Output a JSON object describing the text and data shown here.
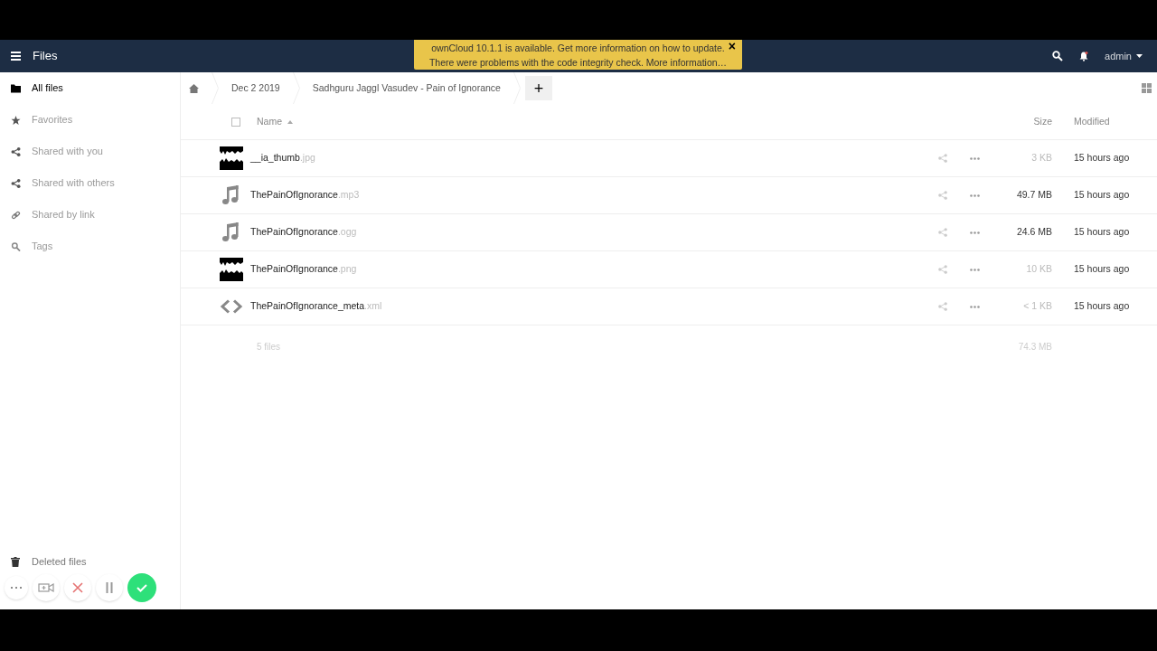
{
  "header": {
    "app_title": "Files",
    "user": "admin"
  },
  "notification": {
    "lines": [
      "ownCloud 10.1.1 is available. Get more information on how to update.",
      "There were problems with the code integrity check. More information…"
    ],
    "close": "×"
  },
  "sidebar": {
    "items": [
      {
        "label": "All files",
        "selected": true
      },
      {
        "label": "Favorites",
        "selected": false
      },
      {
        "label": "Shared with you",
        "selected": false
      },
      {
        "label": "Shared with others",
        "selected": false
      },
      {
        "label": "Shared by link",
        "selected": false
      },
      {
        "label": "Tags",
        "selected": false
      }
    ],
    "footer": {
      "label": "Deleted files"
    }
  },
  "breadcrumbs": [
    "Dec 2 2019",
    "Sadhguru Jaggl Vasudev - Pain of Ignorance"
  ],
  "new_button": "+",
  "table": {
    "select_all": {
      "checked": false
    },
    "columns": {
      "name": "Name",
      "size": "Size",
      "modified": "Modified"
    },
    "rows": [
      {
        "name": "__ia_thumb",
        "ext": ".jpg",
        "size": "3 KB",
        "size_emphasized": false,
        "modified": "15 hours ago"
      },
      {
        "kind": "audio",
        "name": "ThePainOfIgnorance",
        "ext": ".mp3",
        "size": "49.7 MB",
        "size_emphasized": true,
        "modified": "15 hours ago"
      },
      {
        "kind": "audio",
        "name": "ThePainOfIgnorance",
        "ext": ".ogg",
        "size": "24.6 MB",
        "size_emphasized": true,
        "modified": "15 hours ago"
      },
      {
        "name": "ThePainOfIgnorance",
        "ext": ".png",
        "size": "10 KB",
        "size_emphasized": false,
        "modified": "15 hours ago"
      },
      {
        "kind": "code",
        "name": "ThePainOfIgnorance_meta",
        "ext": ".xml",
        "size": "< 1 KB",
        "size_emphasized": false,
        "modified": "15 hours ago"
      }
    ],
    "summary": {
      "count": "5 files",
      "total": "74.3 MB"
    }
  }
}
